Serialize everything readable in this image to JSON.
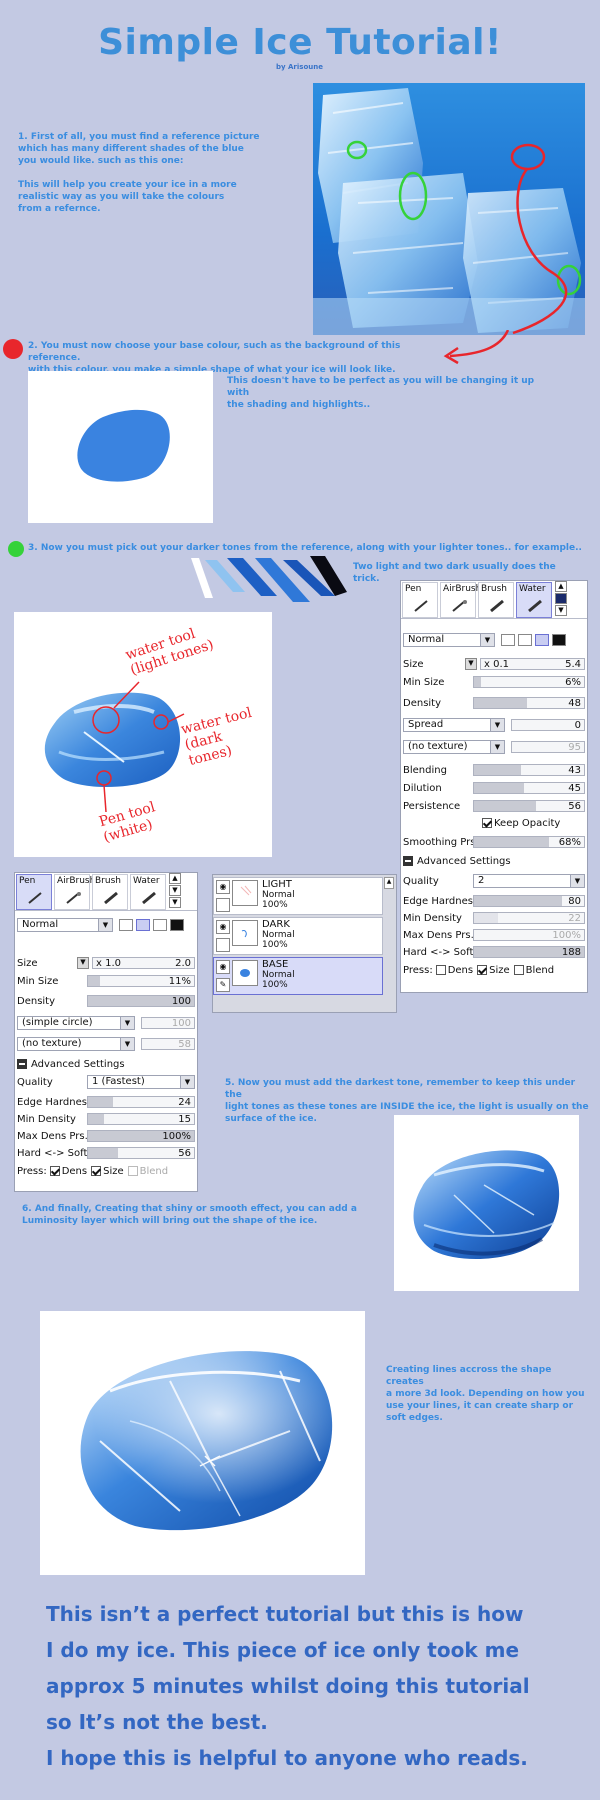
{
  "title": "Simple Ice Tutorial!",
  "byline": "by Arisoune",
  "step1": {
    "line1": "1. First of all, you must find a reference picture",
    "line2": "which has many different shades of the blue",
    "line3": "you would like. such as this one:",
    "line4": "This will help you create your ice in a more",
    "line5": "realistic way as you will take the colours",
    "line6": "from a refernce."
  },
  "step2": {
    "line1": "2. You must now choose your base colour, such as the background of this reference.",
    "line2": "with this colour, you make a simple shape of what your ice will look like.",
    "note1": "This doesn't have to be perfect as you will be changing it up with",
    "note2": "the shading and highlights.."
  },
  "step3": {
    "line1": "3. Now you must pick out your darker tones from the reference, along with your lighter tones.. for example..",
    "line2": "Two light and two dark usually does the trick."
  },
  "annotations": {
    "water_light": "water tool (light tones)",
    "water_dark": "water tool (dark tones)",
    "pen_white": "Pen tool (white)"
  },
  "water_panel": {
    "tabs": [
      "Pen",
      "AirBrush",
      "Brush",
      "Water"
    ],
    "selected_tab": "Water",
    "mode": "Normal",
    "size_label": "Size",
    "size_mult": "x 0.1",
    "size_value": "5.4",
    "min_size_label": "Min Size",
    "min_size_value": "6%",
    "density_label": "Density",
    "density_value": "48",
    "spread_label": "Spread",
    "spread_value": "0",
    "texture_label": "(no texture)",
    "texture_value": "95",
    "blending_label": "Blending",
    "blending_value": "43",
    "dilution_label": "Dilution",
    "dilution_value": "45",
    "persistence_label": "Persistence",
    "persistence_value": "56",
    "keep_opacity": "Keep Opacity",
    "smoothing_label": "Smoothing Prs",
    "smoothing_value": "68%",
    "advanced": "Advanced Settings",
    "quality_label": "Quality",
    "quality_value": "2",
    "edge_label": "Edge Hardness",
    "edge_value": "80",
    "mindens_label": "Min Density",
    "mindens_value": "22",
    "maxdens_label": "Max Dens Prs.",
    "maxdens_value": "100%",
    "hard_label": "Hard <-> Soft",
    "hard_value": "188",
    "press_label": "Press:",
    "press_dens": "Dens",
    "press_size": "Size",
    "press_blend": "Blend"
  },
  "pen_panel": {
    "tabs": [
      "Pen",
      "AirBrush",
      "Brush",
      "Water"
    ],
    "selected_tab": "Pen",
    "mode": "Normal",
    "size_label": "Size",
    "size_mult": "x 1.0",
    "size_value": "2.0",
    "min_size_label": "Min Size",
    "min_size_value": "11%",
    "density_label": "Density",
    "density_value": "100",
    "shape_label": "(simple circle)",
    "shape_value": "100",
    "texture_label": "(no texture)",
    "texture_value": "58",
    "advanced": "Advanced Settings",
    "quality_label": "Quality",
    "quality_value": "1 (Fastest)",
    "edge_label": "Edge Hardness",
    "edge_value": "24",
    "mindens_label": "Min Density",
    "mindens_value": "15",
    "maxdens_label": "Max Dens Prs.",
    "maxdens_value": "100%",
    "hard_label": "Hard <-> Soft",
    "hard_value": "56",
    "press_label": "Press:",
    "press_dens": "Dens",
    "press_size": "Size",
    "press_blend": "Blend"
  },
  "layers": [
    {
      "name": "LIGHT",
      "mode": "Normal",
      "opacity": "100%"
    },
    {
      "name": "DARK",
      "mode": "Normal",
      "opacity": "100%"
    },
    {
      "name": "BASE",
      "mode": "Normal",
      "opacity": "100%"
    }
  ],
  "step5": {
    "line1": "5. Now you must add the darkest tone, remember to keep this under the",
    "line2": "light tones as these tones are INSIDE the ice, the light is usually on the",
    "line3": "surface of the ice."
  },
  "step6": {
    "line1": "6. And finally, Creating that shiny or smooth effect, you can add a",
    "line2": "Luminosity layer which will bring out the shape of the ice."
  },
  "lines_note": {
    "line1": "Creating lines accross the shape creates",
    "line2": "a more 3d look. Depending on how you",
    "line3": "use your lines, it can create sharp or",
    "line4": "soft edges."
  },
  "closing": {
    "line1": "This isn’t a perfect tutorial but this is how",
    "line2": "I do my ice. This piece of ice only took me",
    "line3": "approx 5 minutes whilst doing this tutorial",
    "line4": "so It’s not the best.",
    "line5": "I hope this is helpful to anyone who reads."
  },
  "colors": {
    "background": "#c3c9e3",
    "title": "#3d8fd8",
    "step_text": "#3a8de0",
    "closing_text": "#3367c2",
    "base_blue": "#3a83e0",
    "swatch_light1": "#ffffff",
    "swatch_light2": "#8fc3f0",
    "swatch_dark1": "#1d5fc4",
    "swatch_dark2": "#2f78d8",
    "swatch_darkest": "#0a0a12",
    "marker_red": "#e8262c",
    "marker_green": "#35d23a"
  }
}
